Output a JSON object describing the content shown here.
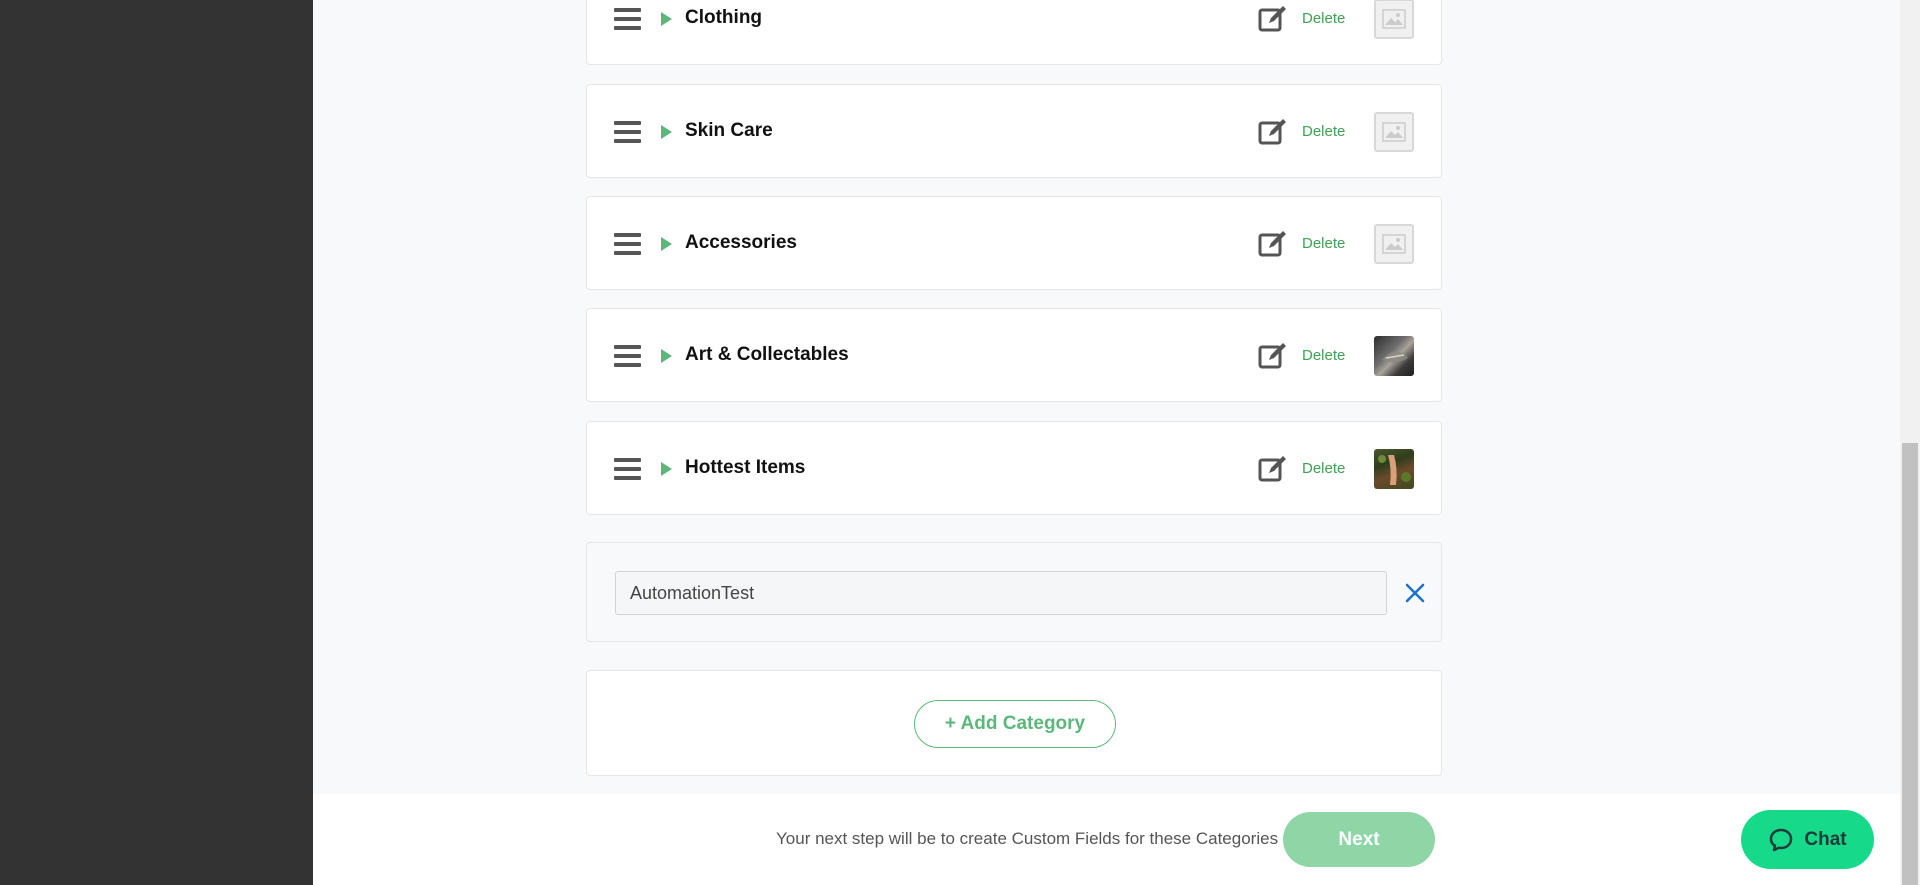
{
  "categories": [
    {
      "name": "Clothing",
      "delete_label": "Delete",
      "image": "placeholder"
    },
    {
      "name": "Skin Care",
      "delete_label": "Delete",
      "image": "placeholder"
    },
    {
      "name": "Accessories",
      "delete_label": "Delete",
      "image": "placeholder"
    },
    {
      "name": "Art & Collectables",
      "delete_label": "Delete",
      "image": "photo-art"
    },
    {
      "name": "Hottest Items",
      "delete_label": "Delete",
      "image": "photo-hot"
    }
  ],
  "new_category": {
    "value": "AutomationTest"
  },
  "add_button": {
    "label": "+ Add Category"
  },
  "footer": {
    "hint": "Your next step will be to create Custom Fields for these Categories",
    "next_label": "Next"
  },
  "chat": {
    "label": "Chat"
  },
  "colors": {
    "accent_green": "#5cb87a",
    "delete_green": "#3aa354",
    "next_disabled": "#8fd6a7",
    "chat_green": "#16d98a",
    "clear_blue": "#1a73c8",
    "sidebar": "#333333"
  }
}
